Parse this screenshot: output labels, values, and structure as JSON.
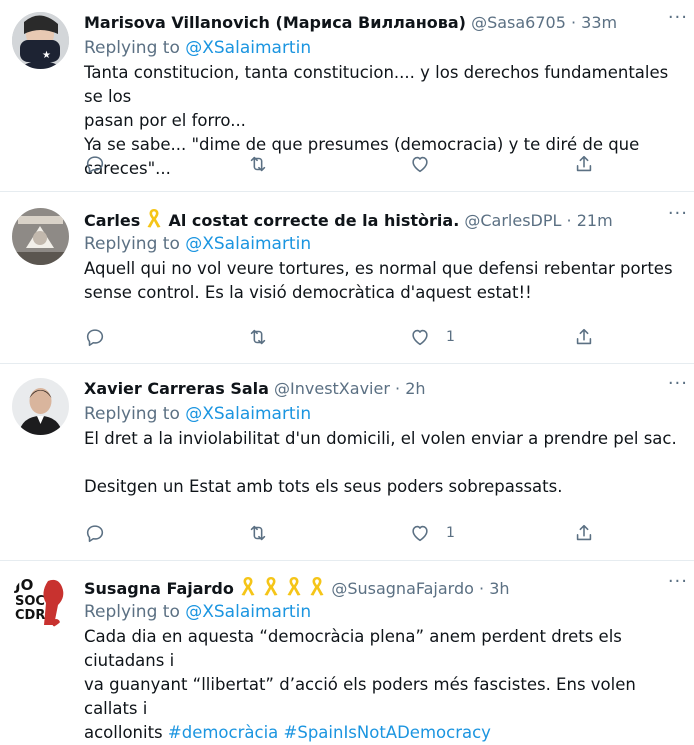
{
  "tweets": [
    {
      "name": "Marisova Villanovich (Мариса Вилланова)",
      "handle": "@Sasa6705",
      "sep": "·",
      "time": "33m",
      "reply_prefix": "Replying to",
      "reply_to": "@XSalaimartin",
      "lines": [
        "Tanta constitucion, tanta constitucion.... y los derechos fundamentales se los",
        "pasan por el forro...",
        "Ya se sabe... \"dime de que presumes (democracia) y te diré de que careces\"..."
      ],
      "like_count": "",
      "more": "···"
    },
    {
      "name": "Carles",
      "name_suffix": "Al costat correcte de la història.",
      "handle": "@CarlesDPL",
      "sep": "·",
      "time": "21m",
      "reply_prefix": "Replying to",
      "reply_to": "@XSalaimartin",
      "lines": [
        "Aquell qui no vol veure tortures, es normal que defensi rebentar portes",
        "sense control. Es la visió democràtica d'aquest estat!!"
      ],
      "like_count": "1",
      "more": "···"
    },
    {
      "name": "Xavier Carreras Sala",
      "handle": "@InvestXavier",
      "sep": "·",
      "time": "2h",
      "reply_prefix": "Replying to",
      "reply_to": "@XSalaimartin",
      "lines": [
        "El dret a la inviolabilitat d'un domicili, el volen enviar a prendre pel sac.",
        "",
        "Desitgen un Estat amb tots els seus poders sobrepassats."
      ],
      "like_count": "1",
      "more": "···"
    },
    {
      "name": "Susagna Fajardo",
      "handle": "@SusagnaFajardo",
      "sep": "·",
      "time": "3h",
      "reply_prefix": "Replying to",
      "reply_to": "@XSalaimartin",
      "lines": [
        "Cada dia en aquesta “democràcia plena” anem perdent drets els ciutadans i",
        "va guanyant “llibertat” d’acció els poders més fascistes. Ens volen callats i",
        "acollonits"
      ],
      "hashtags": [
        "#democràcia",
        "#SpainIsNotADemocracy"
      ],
      "avatar_text": [
        "JO",
        "SOC",
        "CDR"
      ],
      "more": "···"
    }
  ],
  "colors": {
    "accent": "#1b95e0",
    "ribbon": "#f5c518",
    "muted": "#5b7083"
  },
  "icons": [
    "reply-icon",
    "retweet-icon",
    "like-icon",
    "share-icon",
    "ribbon-icon",
    "more-icon"
  ]
}
